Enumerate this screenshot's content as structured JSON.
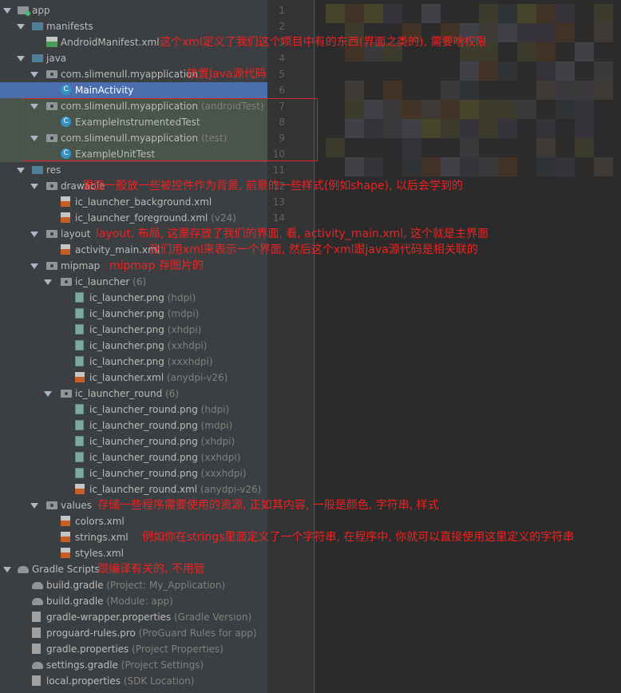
{
  "tree": [
    {
      "label": "app",
      "level": 0,
      "kind": "root",
      "expanded": true
    },
    {
      "label": "manifests",
      "level": 1,
      "kind": "folder",
      "expanded": true
    },
    {
      "label": "AndroidManifest.xml",
      "level": 2,
      "kind": "manifest"
    },
    {
      "label": "java",
      "level": 1,
      "kind": "folder",
      "expanded": true
    },
    {
      "label": "com.slimenull.myapplication",
      "level": 2,
      "kind": "package",
      "expanded": true
    },
    {
      "label": "MainActivity",
      "level": 3,
      "kind": "class",
      "selected": true
    },
    {
      "label": "com.slimenull.myapplication",
      "secondary": "(androidTest)",
      "level": 2,
      "kind": "package",
      "expanded": true,
      "test": true
    },
    {
      "label": "ExampleInstrumentedTest",
      "level": 3,
      "kind": "class",
      "test": true
    },
    {
      "label": "com.slimenull.myapplication",
      "secondary": "(test)",
      "level": 2,
      "kind": "package",
      "expanded": true,
      "test": true
    },
    {
      "label": "ExampleUnitTest",
      "level": 3,
      "kind": "class",
      "test": true
    },
    {
      "label": "res",
      "level": 1,
      "kind": "folder-res",
      "expanded": true
    },
    {
      "label": "drawable",
      "level": 2,
      "kind": "package",
      "expanded": true
    },
    {
      "label": "ic_launcher_background.xml",
      "level": 3,
      "kind": "xml"
    },
    {
      "label": "ic_launcher_foreground.xml",
      "secondary": "(v24)",
      "level": 3,
      "kind": "xml"
    },
    {
      "label": "layout",
      "level": 2,
      "kind": "package",
      "expanded": true
    },
    {
      "label": "activity_main.xml",
      "level": 3,
      "kind": "xml"
    },
    {
      "label": "mipmap",
      "level": 2,
      "kind": "package",
      "expanded": true
    },
    {
      "label": "ic_launcher",
      "secondary": "(6)",
      "level": 3,
      "kind": "package",
      "expanded": true
    },
    {
      "label": "ic_launcher.png",
      "secondary": "(hdpi)",
      "level": 4,
      "kind": "png"
    },
    {
      "label": "ic_launcher.png",
      "secondary": "(mdpi)",
      "level": 4,
      "kind": "png"
    },
    {
      "label": "ic_launcher.png",
      "secondary": "(xhdpi)",
      "level": 4,
      "kind": "png"
    },
    {
      "label": "ic_launcher.png",
      "secondary": "(xxhdpi)",
      "level": 4,
      "kind": "png"
    },
    {
      "label": "ic_launcher.png",
      "secondary": "(xxxhdpi)",
      "level": 4,
      "kind": "png"
    },
    {
      "label": "ic_launcher.xml",
      "secondary": "(anydpi-v26)",
      "level": 4,
      "kind": "xml"
    },
    {
      "label": "ic_launcher_round",
      "secondary": "(6)",
      "level": 3,
      "kind": "package",
      "expanded": true
    },
    {
      "label": "ic_launcher_round.png",
      "secondary": "(hdpi)",
      "level": 4,
      "kind": "png"
    },
    {
      "label": "ic_launcher_round.png",
      "secondary": "(mdpi)",
      "level": 4,
      "kind": "png"
    },
    {
      "label": "ic_launcher_round.png",
      "secondary": "(xhdpi)",
      "level": 4,
      "kind": "png"
    },
    {
      "label": "ic_launcher_round.png",
      "secondary": "(xxhdpi)",
      "level": 4,
      "kind": "png"
    },
    {
      "label": "ic_launcher_round.png",
      "secondary": "(xxxhdpi)",
      "level": 4,
      "kind": "png"
    },
    {
      "label": "ic_launcher_round.xml",
      "secondary": "(anydpi-v26)",
      "level": 4,
      "kind": "xml"
    },
    {
      "label": "values",
      "level": 2,
      "kind": "package",
      "expanded": true
    },
    {
      "label": "colors.xml",
      "level": 3,
      "kind": "xml"
    },
    {
      "label": "strings.xml",
      "level": 3,
      "kind": "xml"
    },
    {
      "label": "styles.xml",
      "level": 3,
      "kind": "xml"
    },
    {
      "label": "Gradle Scripts",
      "level": 0,
      "kind": "gradle",
      "expanded": true
    },
    {
      "label": "build.gradle",
      "secondary": "(Project: My_Application)",
      "level": 1,
      "kind": "gradle"
    },
    {
      "label": "build.gradle",
      "secondary": "(Module: app)",
      "level": 1,
      "kind": "gradle"
    },
    {
      "label": "gradle-wrapper.properties",
      "secondary": "(Gradle Version)",
      "level": 1,
      "kind": "props"
    },
    {
      "label": "proguard-rules.pro",
      "secondary": "(ProGuard Rules for app)",
      "level": 1,
      "kind": "props"
    },
    {
      "label": "gradle.properties",
      "secondary": "(Project Properties)",
      "level": 1,
      "kind": "props"
    },
    {
      "label": "settings.gradle",
      "secondary": "(Project Settings)",
      "level": 1,
      "kind": "gradle"
    },
    {
      "label": "local.properties",
      "secondary": "(SDK Location)",
      "level": 1,
      "kind": "props"
    }
  ],
  "annotations": [
    {
      "row": 2,
      "text": "这个xml定义了我们这个项目中有的东西(界面之类的), 需要啥权限"
    },
    {
      "row": 4,
      "text": "放置Java源代码"
    },
    {
      "row": 11,
      "text": "里面一般放一些被控件作为背景, 前景的一些样式(例如shape), 以后会学到的"
    },
    {
      "row": 14,
      "text": "layout, 布局, 这里存放了我们的界面, 看, activity_main.xml, 这个就是主界面"
    },
    {
      "row": 15,
      "text": "我们用xml来表示一个界面, 然后这个xml跟java源代码是相关联的"
    },
    {
      "row": 16,
      "text": "mipmap 存图片的"
    },
    {
      "row": 31,
      "text": "存储一些程序需要使用的资源, 正如其内容, 一般是颜色, 字符串, 样式"
    },
    {
      "row": 33,
      "text": "例如你在strings里面定义了一个字符串, 在程序中, 你就可以直接使用这里定义的字符串"
    },
    {
      "row": 35,
      "text": "跟编译有关的, 不用管"
    }
  ],
  "gutter": {
    "line_numbers": [
      "1",
      "2",
      "3",
      "4",
      "5",
      "6",
      "7",
      "8",
      "9",
      "10",
      "11",
      "12",
      "13",
      "14"
    ]
  },
  "colors": {
    "annotation": "#ee2222",
    "selection": "#4b6eaf",
    "test_bg": "#49544a",
    "panel": "#3c3f41",
    "editor": "#2b2b2b"
  }
}
